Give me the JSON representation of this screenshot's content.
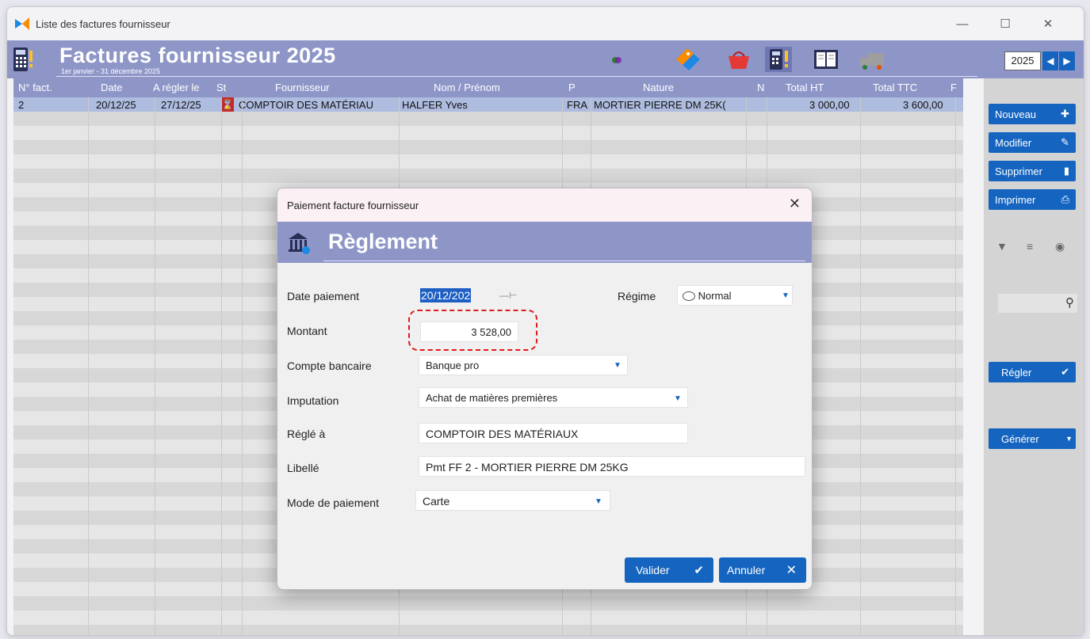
{
  "window": {
    "title": "Liste des factures fournisseur"
  },
  "banner": {
    "heading": "Factures fournisseur 2025",
    "period": "1er janvier - 31 décembre 2025",
    "year": "2025"
  },
  "table": {
    "headers": [
      "N° fact.",
      "Date",
      "A régler le",
      "St",
      "Fournisseur",
      "Nom / Prénom",
      "P",
      "Nature",
      "N",
      "Total HT",
      "Total TTC",
      "F"
    ],
    "row": {
      "num": "2",
      "date": "20/12/25",
      "due": "27/12/25",
      "fournisseur": "COMPTOIR DES MATÉRIAU",
      "nom": "HALFER Yves",
      "p": "FRA",
      "nature": "MORTIER PIERRE DM 25K(",
      "ht": "3 000,00",
      "ttc": "3 600,00"
    }
  },
  "sidebar": {
    "nouveau": "Nouveau",
    "modifier": "Modifier",
    "supprimer": "Supprimer",
    "imprimer": "Imprimer",
    "regler": "Régler",
    "generer": "Générer"
  },
  "modal": {
    "title": "Paiement facture fournisseur",
    "heading": "Règlement",
    "labels": {
      "date": "Date paiement",
      "montant": "Montant",
      "compte": "Compte bancaire",
      "imputation": "Imputation",
      "regle": "Réglé à",
      "libelle": "Libellé",
      "mode": "Mode de paiement",
      "regime": "Régime"
    },
    "values": {
      "date": "20/12/202",
      "montant": "3 528,00",
      "compte": "Banque pro",
      "imputation": "Achat de matières premières",
      "regle": "COMPTOIR DES MATÉRIAUX",
      "libelle": "Pmt FF 2 - MORTIER PIERRE DM 25KG",
      "mode": "Carte",
      "regime": "Normal"
    },
    "buttons": {
      "valider": "Valider",
      "annuler": "Annuler"
    }
  },
  "colors": {
    "banner": "#8e96c8",
    "accent": "#1565c0",
    "highlight": "#e0191b"
  }
}
